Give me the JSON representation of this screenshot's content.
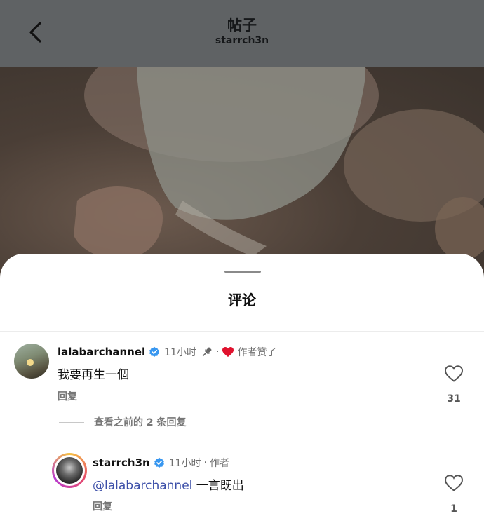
{
  "header": {
    "title": "帖子",
    "subtitle": "starrch3n"
  },
  "sheet": {
    "title": "评论"
  },
  "comments": [
    {
      "username": "lalabarchannel",
      "time": "11小时",
      "separator": "·",
      "author_liked": "作者赞了",
      "text": "我要再生一個",
      "reply_label": "回复",
      "like_count": "31"
    }
  ],
  "view_previous": "查看之前的 2 条回复",
  "replies": [
    {
      "username": "starrch3n",
      "time": "11小时",
      "separator": "·",
      "author_tag": "作者",
      "mention": "@lalabarchannel",
      "text": " 一言既出",
      "reply_label": "回复",
      "like_count": "1"
    }
  ],
  "colors": {
    "header_bg": "#5f6264",
    "verified": "#3897f0",
    "heart_red": "#e0122e",
    "mention": "#3b4ea8"
  },
  "icons": [
    "chevron-left-icon",
    "verified-badge-icon",
    "pin-icon",
    "heart-filled-icon",
    "heart-outline-icon"
  ]
}
